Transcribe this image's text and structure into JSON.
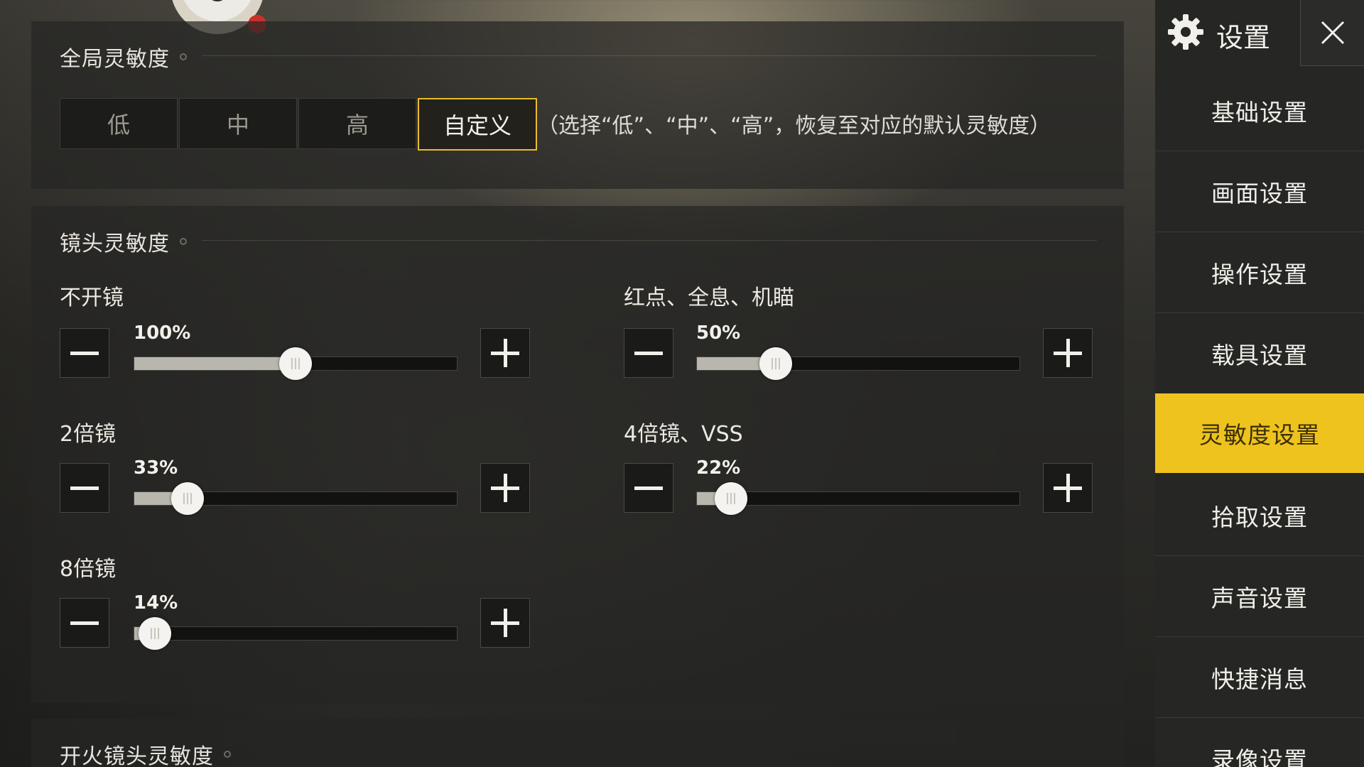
{
  "global": {
    "title": "全局灵敏度",
    "presets": [
      "低",
      "中",
      "高",
      "自定义"
    ],
    "active_preset": "自定义",
    "note": "（选择“低”、“中”、“高”，恢复至对应的默认灵敏度）"
  },
  "camera": {
    "title": "镜头灵敏度",
    "sliders": [
      {
        "label": "不开镜",
        "value_text": "100%",
        "fraction": 0.5
      },
      {
        "label": "红点、全息、机瞄",
        "value_text": "50%",
        "fraction": 0.245
      },
      {
        "label": "2倍镜",
        "value_text": "33%",
        "fraction": 0.165
      },
      {
        "label": "4倍镜、VSS",
        "value_text": "22%",
        "fraction": 0.105
      },
      {
        "label": "8倍镜",
        "value_text": "14%",
        "fraction": 0.063
      }
    ]
  },
  "fire": {
    "title": "开火镜头灵敏度"
  },
  "sidebar": {
    "title": "设置",
    "items": [
      "基础设置",
      "画面设置",
      "操作设置",
      "载具设置",
      "灵敏度设置",
      "拾取设置",
      "声音设置",
      "快捷消息",
      "录像设置"
    ],
    "active_index": 4
  },
  "colors": {
    "accent": "#efc31d",
    "active_preset_border": "#e8bd2a"
  },
  "icons": [
    "gear-icon",
    "close-icon",
    "minus-icon",
    "plus-icon",
    "avatar-icon"
  ]
}
